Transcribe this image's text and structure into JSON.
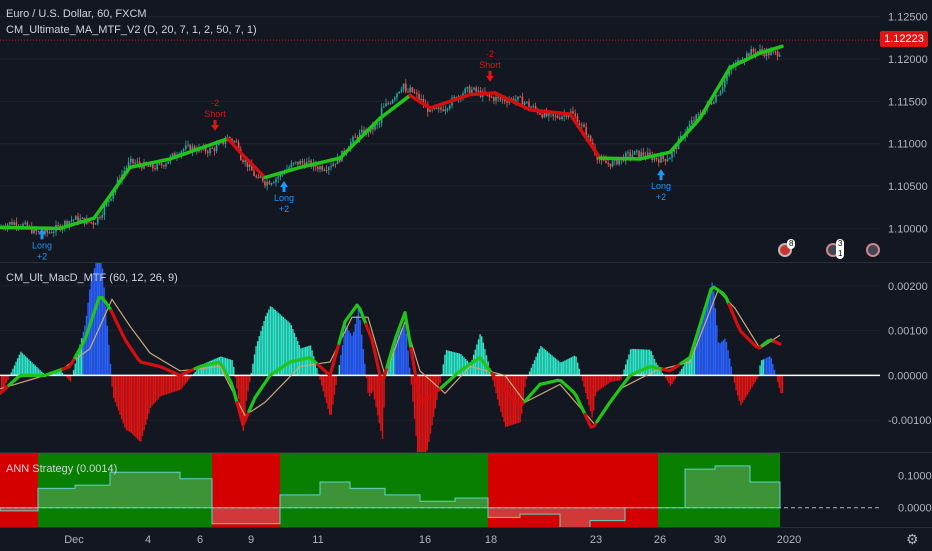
{
  "header": {
    "symbol": "Euro / U.S. Dollar, 60, FXCM",
    "indicator1": "CM_Ultimate_MA_MTF_V2 (D, 20, 7, 1, 2, 50, 7, 1)",
    "indicator2": "CM_Ult_MacD_MTF (60, 12, 26, 9)",
    "indicator3": "ANN Strategy (0.0014)",
    "last_price": "1.12223"
  },
  "colors": {
    "background": "#131722",
    "up": "#26a69a",
    "down": "#ef5350",
    "ma_up": "#22c41b",
    "ma_down": "#d40f0f",
    "long": "#2196f3",
    "short": "#e01414",
    "hist_pos_strong": "#2962ff",
    "hist_pos_weak": "#2ee6c8",
    "hist_neg": "#e01414",
    "ann_long_bg": "#087f00",
    "ann_short_bg": "#d40000"
  },
  "chart_data": [
    {
      "type": "candlestick",
      "title": "Euro / U.S. Dollar, 60, FXCM",
      "ylim": [
        1.0965,
        1.1265
      ],
      "y_ticks": [
        "1.12500",
        "1.12000",
        "1.11500",
        "1.11000",
        "1.10500",
        "1.10000"
      ],
      "x_ticks": [
        "Dec",
        "4",
        "6",
        "9",
        "11",
        "16",
        "18",
        "23",
        "26",
        "30",
        "2020"
      ],
      "ma_path": [
        [
          0,
          1.1001,
          "up"
        ],
        [
          60,
          1.1,
          "up"
        ],
        [
          94,
          1.1012,
          "up"
        ],
        [
          130,
          1.1072,
          "up"
        ],
        [
          170,
          1.1082,
          "up"
        ],
        [
          228,
          1.1106,
          "up"
        ],
        [
          240,
          1.109,
          "down"
        ],
        [
          265,
          1.106,
          "down"
        ],
        [
          300,
          1.1072,
          "up"
        ],
        [
          340,
          1.1083,
          "up"
        ],
        [
          380,
          1.113,
          "up"
        ],
        [
          410,
          1.1157,
          "up"
        ],
        [
          430,
          1.1142,
          "down"
        ],
        [
          470,
          1.1158,
          "down"
        ],
        [
          495,
          1.116,
          "down"
        ],
        [
          530,
          1.114,
          "down"
        ],
        [
          570,
          1.1135,
          "down"
        ],
        [
          600,
          1.1083,
          "down"
        ],
        [
          640,
          1.1082,
          "up"
        ],
        [
          670,
          1.109,
          "up"
        ],
        [
          700,
          1.113,
          "up"
        ],
        [
          730,
          1.119,
          "up"
        ],
        [
          760,
          1.1207,
          "up"
        ],
        [
          782,
          1.1215,
          "up"
        ]
      ],
      "annotations": [
        {
          "kind": "long",
          "label": "Long",
          "value": "+2",
          "x": 42,
          "price": 1.1
        },
        {
          "kind": "short",
          "label": "Short",
          "value": "-2",
          "x": 215,
          "price": 1.1115
        },
        {
          "kind": "long",
          "label": "Long",
          "value": "+2",
          "x": 284,
          "price": 1.1056
        },
        {
          "kind": "short",
          "label": "Short",
          "value": "-2",
          "x": 490,
          "price": 1.1173
        },
        {
          "kind": "long",
          "label": "Long",
          "value": "+2",
          "x": 661,
          "price": 1.107
        }
      ]
    },
    {
      "type": "line",
      "title": "CM_Ult_MacD_MTF (60, 12, 26, 9)",
      "ylim": [
        -0.0016,
        0.0024
      ],
      "y_ticks": [
        "0.00200",
        "0.00100",
        "0.00000",
        "-0.00100"
      ],
      "macd_points": [
        [
          0,
          -0.0004
        ],
        [
          20,
          0.0
        ],
        [
          45,
          0.0
        ],
        [
          70,
          0.0002
        ],
        [
          85,
          0.0008
        ],
        [
          100,
          0.0018
        ],
        [
          110,
          0.0015
        ],
        [
          125,
          0.0008
        ],
        [
          140,
          0.0003
        ],
        [
          160,
          0.0002
        ],
        [
          180,
          0.0
        ],
        [
          200,
          0.0002
        ],
        [
          220,
          0.0003
        ],
        [
          232,
          -0.0002
        ],
        [
          243,
          -0.0011
        ],
        [
          255,
          -0.0005
        ],
        [
          270,
          0.0
        ],
        [
          290,
          0.0003
        ],
        [
          310,
          0.0004
        ],
        [
          330,
          0.0
        ],
        [
          345,
          0.0012
        ],
        [
          358,
          0.0016
        ],
        [
          372,
          0.0008
        ],
        [
          382,
          -0.0002
        ],
        [
          395,
          0.0008
        ],
        [
          405,
          0.0014
        ],
        [
          420,
          -0.0006
        ],
        [
          440,
          -0.0003
        ],
        [
          460,
          0.0001
        ],
        [
          480,
          0.0004
        ],
        [
          500,
          -0.0002
        ],
        [
          520,
          -0.0007
        ],
        [
          540,
          -0.0002
        ],
        [
          560,
          -0.0001
        ],
        [
          575,
          -0.0004
        ],
        [
          592,
          -0.0012
        ],
        [
          610,
          -0.0006
        ],
        [
          630,
          0.0
        ],
        [
          650,
          0.0002
        ],
        [
          670,
          0.0001
        ],
        [
          690,
          0.0004
        ],
        [
          712,
          0.002
        ],
        [
          725,
          0.0018
        ],
        [
          740,
          0.001
        ],
        [
          758,
          0.0006
        ],
        [
          770,
          0.0008
        ],
        [
          780,
          0.0007
        ]
      ],
      "signal_points": [
        [
          0,
          -0.0003
        ],
        [
          30,
          -0.0001
        ],
        [
          60,
          0.0001
        ],
        [
          90,
          0.0006
        ],
        [
          112,
          0.0017
        ],
        [
          130,
          0.0011
        ],
        [
          150,
          0.0005
        ],
        [
          180,
          0.0001
        ],
        [
          220,
          0.0002
        ],
        [
          245,
          -0.0009
        ],
        [
          265,
          -0.0006
        ],
        [
          300,
          0.0002
        ],
        [
          330,
          0.0003
        ],
        [
          352,
          0.0013
        ],
        [
          368,
          0.0013
        ],
        [
          385,
          0.0
        ],
        [
          405,
          0.0012
        ],
        [
          420,
          0.0001
        ],
        [
          445,
          -0.0004
        ],
        [
          470,
          0.0002
        ],
        [
          505,
          0.0
        ],
        [
          525,
          -0.0006
        ],
        [
          560,
          -0.0002
        ],
        [
          595,
          -0.0011
        ],
        [
          620,
          -0.0003
        ],
        [
          655,
          0.0001
        ],
        [
          690,
          0.0003
        ],
        [
          718,
          0.0019
        ],
        [
          735,
          0.0015
        ],
        [
          760,
          0.0006
        ],
        [
          780,
          0.0009
        ]
      ]
    },
    {
      "type": "area",
      "title": "ANN Strategy (0.0014)",
      "ylim": [
        -0.06,
        0.17
      ],
      "y_ticks": [
        "0.10000",
        "0.00000"
      ],
      "regimes": [
        {
          "from": 0,
          "to": 38,
          "state": "short"
        },
        {
          "from": 38,
          "to": 212,
          "state": "long"
        },
        {
          "from": 212,
          "to": 280,
          "state": "short"
        },
        {
          "from": 280,
          "to": 488,
          "state": "long"
        },
        {
          "from": 488,
          "to": 658,
          "state": "short"
        },
        {
          "from": 658,
          "to": 780,
          "state": "long"
        }
      ],
      "steps": [
        [
          0,
          -0.01
        ],
        [
          38,
          0.06
        ],
        [
          75,
          0.07
        ],
        [
          110,
          0.11
        ],
        [
          180,
          0.09
        ],
        [
          212,
          -0.05
        ],
        [
          250,
          -0.05
        ],
        [
          280,
          0.04
        ],
        [
          320,
          0.08
        ],
        [
          350,
          0.06
        ],
        [
          385,
          0.04
        ],
        [
          420,
          0.02
        ],
        [
          455,
          0.03
        ],
        [
          488,
          -0.03
        ],
        [
          520,
          -0.02
        ],
        [
          560,
          -0.07
        ],
        [
          590,
          -0.04
        ],
        [
          625,
          0.0
        ],
        [
          658,
          0.0
        ],
        [
          685,
          0.12
        ],
        [
          715,
          0.13
        ],
        [
          750,
          0.08
        ],
        [
          780,
          0.08
        ]
      ]
    }
  ]
}
